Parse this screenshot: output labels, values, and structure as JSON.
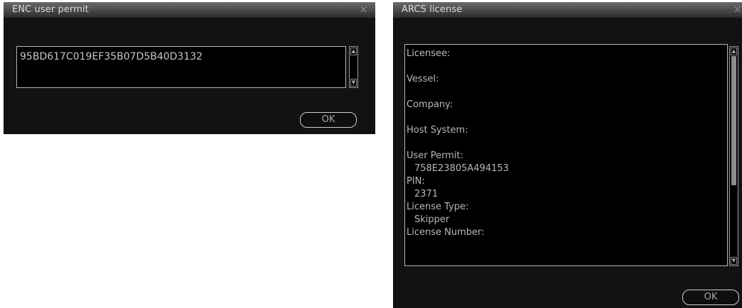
{
  "enc_dialog": {
    "title": "ENC user permit",
    "close_label": "×",
    "permit_value": "95BD617C019EF35B07D5B40D3132",
    "scroll_up": "▲",
    "scroll_down": "▼",
    "ok_label": "OK"
  },
  "arcs_dialog": {
    "title": "ARCS license",
    "close_label": "×",
    "scroll_up": "▲",
    "scroll_down": "▼",
    "ok_label": "OK",
    "fields": {
      "licensee_label": "Licensee:",
      "vessel_label": "Vessel:",
      "company_label": "Company:",
      "host_system_label": "Host System:",
      "user_permit_label": "User Permit:",
      "user_permit_value": "758E23805A494153",
      "pin_label": "PIN:",
      "pin_value": "2371",
      "license_type_label": "License Type:",
      "license_type_value": "Skipper",
      "license_number_label": "License Number:"
    }
  }
}
